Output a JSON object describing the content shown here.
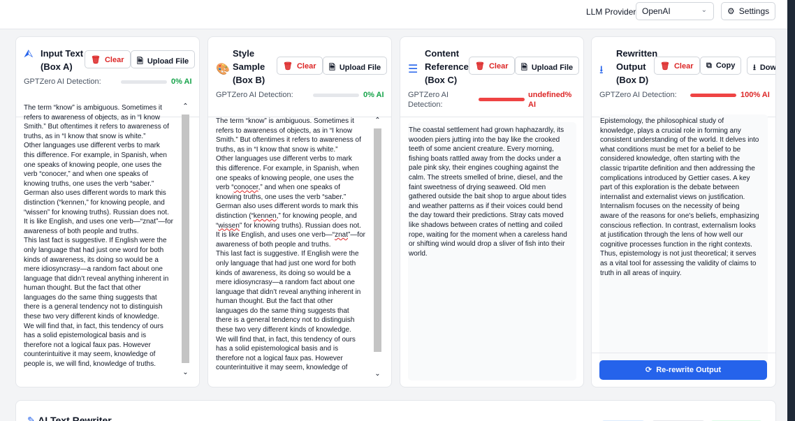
{
  "topbar": {
    "provider_label": "LLM Provider:",
    "provider_value": "OpenAI",
    "settings_label": "Settings"
  },
  "colors": {
    "accent": "#2563eb",
    "danger": "#dc2626",
    "success": "#16a34a"
  },
  "boxes": {
    "a": {
      "title_line1": "Input Text",
      "title_line2": "(Box A)",
      "icon": "upload-icon",
      "clear": "Clear",
      "upload": "Upload File",
      "detect_label": "GPTZero AI Detection:",
      "detect_pct": "0% AI",
      "detect_value": 0,
      "text": "The term “know” is ambiguous. Sometimes it\nrefers to awareness of objects, as in “I know\nSmith.” But oftentimes it refers to awareness of\ntruths, as in “I know that snow is white.”\nOther languages use different verbs to mark\nthis difference. For example, in Spanish, when\none speaks of knowing people, one uses the\nverb “conocer,” and when one speaks of\nknowing truths, one uses the verb “saber.”\nGerman also uses different words to mark this\ndistinction (“kennen,” for knowing people, and\n“wissen” for knowing truths). Russian does not.\nIt is like English, and uses one verb—“znat”—for\nawareness of both people and truths.\nThis last fact is suggestive. If English were the\nonly language that had just one word for both\nkinds of awareness, its doing so would be a\nmere idiosyncrasy—a random fact about one\nlanguage that didn’t reveal anything inherent in\nhuman thought. But the fact that other\nlanguages do the same thing suggests that\nthere is a general tendency not to distinguish\nthese two very different kinds of knowledge.\nWe will find that, in fact, this tendency of ours\nhas a solid epistemological basis and is\ntherefore not a logical faux pas. However\ncounterintuitive it may seem, knowledge of\npeople is, we will find, knowledge of truths."
    },
    "b": {
      "title_line1": "Style",
      "title_line2": "Sample",
      "title_line3": "(Box B)",
      "icon": "palette-icon",
      "clear": "Clear",
      "upload": "Upload File",
      "detect_label": "GPTZero AI Detection:",
      "detect_pct": "0% AI",
      "detect_value": 0,
      "text_1": "The term “know” is ambiguous. Sometimes it\nrefers to awareness of objects, as in “I know\nSmith.” But oftentimes it refers to awareness of\ntruths, as in “I know that snow is white.”\nOther languages use different verbs to mark\nthis difference. For example, in Spanish, when\none speaks of knowing people, one uses the\nverb “",
      "word_conocer": "conocer",
      "text_2": ",” and when one speaks of\nknowing truths, one uses the verb “saber.”\nGerman also uses different words to mark this\ndistinction (“",
      "word_kennen": "kennen",
      "text_3": ",” for knowing people, and\n“",
      "word_wissen": "wissen",
      "text_4": "” for knowing truths). Russian does not.\nIt is like English, and uses one verb—“",
      "word_znat": "znat",
      "text_5": "”—for\nawareness of both people and truths.\nThis last fact is suggestive. If English were the\nonly language that had just one word for both\nkinds of awareness, its doing so would be a\nmere idiosyncrasy—a random fact about one\nlanguage that didn’t reveal anything inherent in\nhuman thought. But the fact that other\nlanguages do the same thing suggests that\nthere is a general tendency not to distinguish\nthese two very different kinds of knowledge.\nWe will find that, in fact, this tendency of ours\nhas a solid epistemological basis and is\ntherefore not a logical faux pas. However\ncounterintuitive it may seem, knowledge of"
    },
    "c": {
      "title_line1": "Content",
      "title_line2": "Reference",
      "title_line3": "(Box C)",
      "icon": "layers-icon",
      "clear": "Clear",
      "upload": "Upload File",
      "detect_label_1": "GPTZero AI",
      "detect_label_2": "Detection:",
      "detect_pct_1": "undefined%",
      "detect_pct_2": "AI",
      "text": "The coastal settlement had grown haphazardly, its\nwooden piers jutting into the bay like the crooked\nteeth of some ancient creature. Every morning,\nfishing boats rattled away from the docks under a\npale pink sky, their engines coughing against the\ncalm. The streets smelled of brine, diesel, and the\nfaint sweetness of drying seaweed. Old men\ngathered outside the bait shop to argue about tides\nand weather patterns as if their voices could bend\nthe day toward their predictions. Stray cats moved\nlike shadows between crates of netting and coiled\nrope, waiting for the moment when a careless hand\nor shifting wind would drop a sliver of fish into their\nworld."
    },
    "d": {
      "title_line1": "Rewritten",
      "title_line2": "Output",
      "title_line3": "(Box D)",
      "icon": "download-icon",
      "clear": "Clear",
      "copy": "Copy",
      "download": "Downl",
      "detect_label": "GPTZero AI Detection:",
      "detect_pct": "100% AI",
      "detect_value": 100,
      "text": "Epistemology, the philosophical study of\nknowledge, plays a crucial role in forming any\nconsistent understanding of the world. It delves into\nwhat conditions must be met for a belief to be\nconsidered knowledge, often starting with the\nclassic tripartite definition and then addressing the\ncomplications introduced by Gettier cases. A key\npart of this exploration is the debate between\ninternalist and externalist views on justification.\nInternalism focuses on the necessity of being\naware of the reasons for one's beliefs, emphasizing\nconscious reflection. In contrast, externalism looks\nat justification through the lens of how well our\ncognitive processes function in the right contexts.\nThus, epistemology is not just theoretical; it serves\nas a vital tool for assessing the validity of claims to\ntruth in all areas of inquiry.",
      "rewrite_label": "Re-rewrite Output"
    }
  },
  "bottom": {
    "title": "AI Text Rewriter"
  }
}
